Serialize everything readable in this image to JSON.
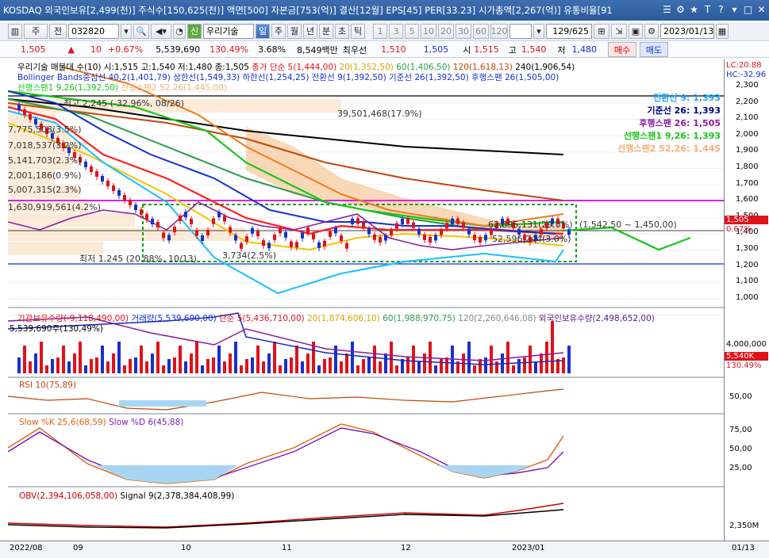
{
  "title": {
    "text": "KOSDAQ 외국인보유[2,499(천)] 주식수[150,625(천)] 액면[500] 자본금[753(억)] 결산[12월] EPS[45] PER[33.23] 시가총액[2,267(억)] 유통비율[91",
    "icons": [
      "menu-icon",
      "settings-icon",
      "pin-icon",
      "text-icon",
      "help-icon",
      "minimize-icon",
      "maximize-icon",
      "close-icon"
    ],
    "glyphs": [
      "☰",
      "⚙",
      "★",
      "T",
      "?",
      "▾",
      "□",
      "✕"
    ]
  },
  "toolbar": {
    "period_a": "주",
    "period_b": "전",
    "code": "032820",
    "badge": "신",
    "stock_name": "우리기술",
    "modes": [
      "일",
      "주",
      "월",
      "년",
      "분",
      "초",
      "틱"
    ],
    "numbers": [
      "1",
      "3",
      "5",
      "10",
      "20",
      "30",
      "60",
      "120"
    ],
    "counter": "129/625",
    "date": "2023/01/13"
  },
  "quote": {
    "price": "1,505",
    "change_arrow": "▲",
    "change": "10",
    "change_pct": "+0.67%",
    "volume": "5,539,690",
    "vol_ratio": "130.49%",
    "turnover": "3.68%",
    "amount": "8,549백만",
    "best_label": "최우선",
    "bid": "1,510",
    "ask": "1,505",
    "open_label": "시",
    "open": "1,515",
    "high_label": "고",
    "high": "1,540",
    "low_label": "저",
    "low": "1,480",
    "buy": "매수",
    "sell": "매도"
  },
  "price_panel": {
    "header1": "우리기술 매물대 수(10)  시:1,515 고:1,540 저:1,480 종:1,505",
    "header1b": "종가 단순 5(1,444,00)",
    "header1c": "20(1,352,50)",
    "header1d": "60(1,406,50)",
    "header1e": "120(1,618,13)",
    "header1f": "240(1,906,54)",
    "header2": "Bollinger Bands중심선 40,2(1,401,79) 상한선(1,549,33) 하한선(1,254,25)  전환선 9(1,392,50)  기준선 26(1,392,50)  후행스팬 26(1,505,00)",
    "header3": "선행스팬1 9,26(1,392,50)",
    "header3b": "선행스팬2 52,26(1,445,00)",
    "legend": [
      {
        "text": "전환선  9: 1,393",
        "color": "#1aa3ff"
      },
      {
        "text": "기준선  26: 1,393",
        "color": "#000080"
      },
      {
        "text": "후행스팬  26: 1,505",
        "color": "#8b1a9c"
      },
      {
        "text": "선행스팬1 9,26: 1,393",
        "color": "#19c619"
      },
      {
        "text": "선행스팬2 52,26: 1,445",
        "color": "#f5b07a"
      }
    ],
    "vp_labels": [
      "39,501,468(17.9%)",
      "7,775,508(3.5%)",
      "7,018,537(3.2%)",
      "5,141,703(2.3%)",
      "2,001,186(0.9%)",
      "5,007,315(2.3%)",
      "1,630,919,561(4.2%)"
    ],
    "max_label": "최고 2,245 (-32.96%, 08/26)",
    "min_label": "최저 1,245 (20.88%, 10/13)",
    "box_label": "(1,542,50 ~ 1,450,00)",
    "small_labels": [
      "3,734(2.5%)",
      "62,895,131(29.0%)",
      "52,596,244(3.0%)"
    ],
    "right_top": "LC:20.88",
    "right_top2": "HC:-32.96",
    "price_ticks": [
      "2,300",
      "2,200",
      "2,100",
      "2,000",
      "1,900",
      "1,800",
      "1,700",
      "1,600",
      "1,500",
      "1,400",
      "1,300",
      "1,200",
      "1,100",
      "1,000"
    ],
    "current_tag": "1,505",
    "pct_tag": "0.67%"
  },
  "volume_panel": {
    "header": "기관보유수량(-9,118,490,00)",
    "header_b": "거래량(5,539,690,00)",
    "header_c": "단순 5(5,436,710,00)",
    "header_d": "20(1,874,606,10)",
    "header_e": "60(1,988,970,75)",
    "header_f": "120(2,260,646,08)",
    "header_g": "외국인보유수량(2,498,652,00)",
    "sub": "5,539,690주(130,49%)",
    "tick": "4,000,000",
    "tag": "5,540K",
    "tag2": "130.49%"
  },
  "rsi_panel": {
    "header": "RSI 10(75,89)",
    "tick": "50,00"
  },
  "stoch_panel": {
    "header_k": "Slow %K 25,6(68,59)",
    "header_d": "Slow %D 6(45,88)",
    "ticks": [
      "75,00",
      "50,00",
      "25,00"
    ]
  },
  "obv_panel": {
    "header": "OBV(2,394,106,058,00)",
    "header_b": "Signal 9(2,378,384,408,99)",
    "tick": "2,350M"
  },
  "x_axis": [
    "2022/08",
    "09",
    "10",
    "11",
    "12",
    "2023/01",
    "01/13"
  ],
  "colors": {
    "up": "#e0121b",
    "down": "#1530d0",
    "ma20": "#f5c400",
    "ma60": "#2a9d4b",
    "ma120": "#c0470e",
    "ma240": "#000000",
    "ma5": "#ff2020",
    "magenta": "#e020e0"
  }
}
